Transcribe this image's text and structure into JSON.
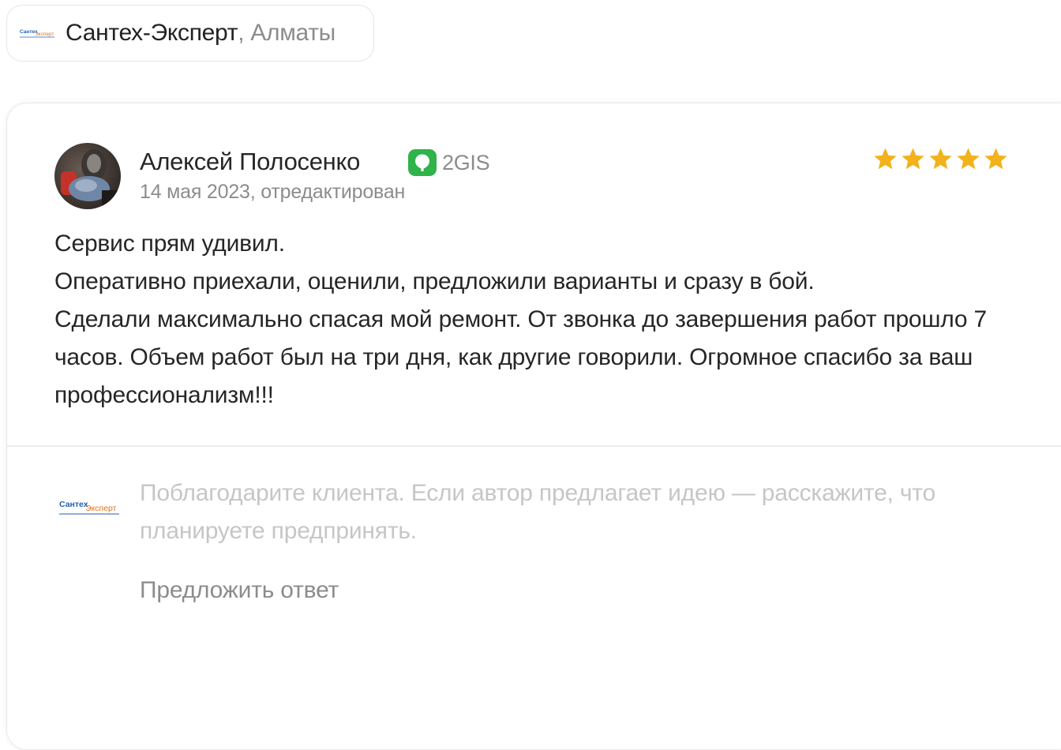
{
  "org": {
    "logo_text_a": "Сантех",
    "logo_text_b": "Эксперт",
    "name": "Сантех-Эксперт",
    "city": ", Алматы"
  },
  "review": {
    "author": "Алексей Полосенко",
    "source": "2GIS",
    "date": "14 мая 2023, отредактирован",
    "rating": 5,
    "rating_max": 5,
    "text_lines": [
      "Сервис прям удивил.",
      "Оперативно приехали, оценили, предложили варианты и сразу в бой.",
      "Сделали максимально спасая мой ремонт. От звонка до завершения работ прошло 7 часов. Объем работ был на три дня, как другие говорили. Огромное спасибо за ваш профессионализм!!!"
    ]
  },
  "reply": {
    "placeholder": "Поблагодарите клиента. Если автор предлагает идею — расскажите, что планируете предпринять.",
    "suggest_label": "Предложить ответ"
  },
  "colors": {
    "star": "#f2b21b",
    "source_green": "#2fb34a",
    "logo_blue": "#1f5fb4",
    "logo_orange": "#e8711d"
  }
}
